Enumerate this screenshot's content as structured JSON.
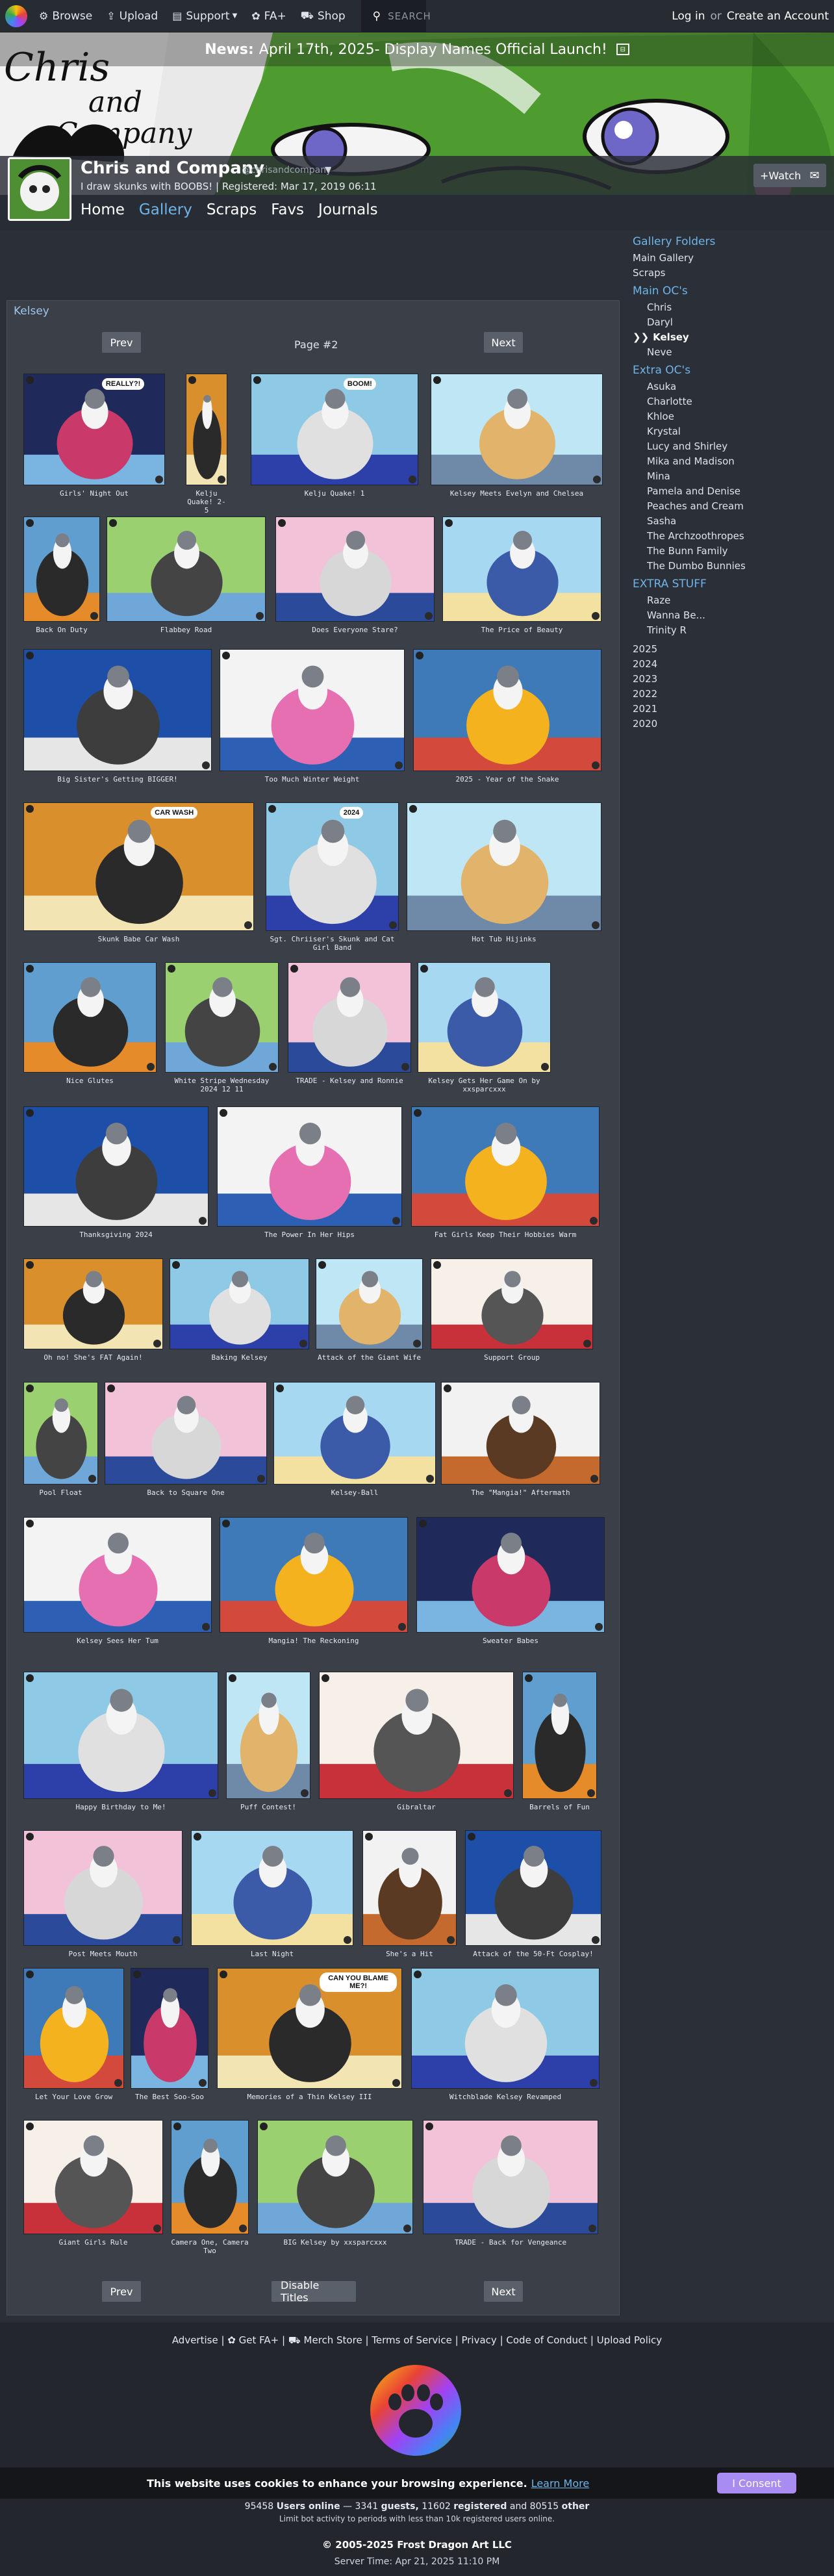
{
  "nav": {
    "browse": "Browse",
    "upload": "Upload",
    "support": "Support",
    "faplus": "FA+",
    "shop": "Shop",
    "search_placeholder": "SEARCH",
    "login": "Log in",
    "or": "or",
    "create": "Create an Account"
  },
  "news": {
    "label": "News:",
    "text": "April 17th, 2025- Display Names Official Launch!"
  },
  "banner_text": {
    "line1": "Chris",
    "line2": "and",
    "line3": "Company"
  },
  "user": {
    "name": "Chris and Company",
    "status": "@chrisandcompany",
    "tagline": "I draw skunks with BOOBS! | Registered: Mar 17, 2019 06:11",
    "watch": "+Watch",
    "tabs": [
      "Home",
      "Gallery",
      "Scraps",
      "Favs",
      "Journals"
    ]
  },
  "sidebar": {
    "gallery_folders": "Gallery Folders",
    "main_gallery": "Main Gallery",
    "scraps": "Scraps",
    "main_ocs": "Main OC's",
    "main_oc_items": [
      "Chris",
      "Daryl",
      "Kelsey",
      "Neve"
    ],
    "current_marker": "❯❯",
    "extra_ocs": "Extra OC's",
    "extra_oc_items": [
      "Asuka",
      "Charlotte",
      "Khloe",
      "Krystal",
      "Lucy and Shirley",
      "Mika and Madison",
      "Mina",
      "Pamela and Denise",
      "Peaches and Cream",
      "Sasha",
      "The Archzoothropes",
      "The Bunn Family",
      "The Dumbo Bunnies"
    ],
    "extra_stuff": "EXTRA STUFF",
    "extra_stuff_items": [
      "Raze",
      "Wanna Be...",
      "Trinity R"
    ],
    "years": [
      "2025",
      "2024",
      "2023",
      "2022",
      "2021",
      "2020"
    ]
  },
  "gallery": {
    "title": "Kelsey",
    "prev": "Prev",
    "next": "Next",
    "page": "Page #2",
    "disable_titles": "Disable Titles",
    "thumbs": [
      {
        "caption": "Girls' Night Out",
        "bubble": "REALLY?!"
      },
      {
        "caption": "Kelju Quake! 2-5"
      },
      {
        "caption": "Kelju Quake! 1",
        "bubble": "BOOM!"
      },
      {
        "caption": "Kelsey Meets Evelyn and Chelsea"
      },
      {
        "caption": "Back On Duty"
      },
      {
        "caption": "Flabbey Road"
      },
      {
        "caption": "Does Everyone Stare?"
      },
      {
        "caption": "The Price of Beauty"
      },
      {
        "caption": "Big Sister's Getting BIGGER!"
      },
      {
        "caption": "Too Much Winter Weight"
      },
      {
        "caption": "2025 - Year of the Snake"
      },
      {
        "caption": "Skunk Babe Car Wash",
        "bubble": "CAR WASH"
      },
      {
        "caption": "Sgt. Chriiser's Skunk and Cat Girl Band",
        "bubble": "2024"
      },
      {
        "caption": "Hot Tub Hijinks"
      },
      {
        "caption": "Nice Glutes"
      },
      {
        "caption": "White Stripe Wednesday 2024 12 11"
      },
      {
        "caption": "TRADE - Kelsey and Ronnie"
      },
      {
        "caption": "Kelsey Gets Her Game On by xxsparcxxx"
      },
      {
        "caption": "Thanksgiving 2024"
      },
      {
        "caption": "The Power In Her Hips"
      },
      {
        "caption": "Fat Girls Keep Their Hobbies Warm"
      },
      {
        "caption": "Oh no! She's FAT Again!"
      },
      {
        "caption": "Baking Kelsey"
      },
      {
        "caption": "Attack of the Giant Wife"
      },
      {
        "caption": "Support Group"
      },
      {
        "caption": "Pool Float"
      },
      {
        "caption": "Back to Square One"
      },
      {
        "caption": "Kelsey-Ball"
      },
      {
        "caption": "The \"Mangia!\" Aftermath"
      },
      {
        "caption": "Kelsey Sees Her Tum"
      },
      {
        "caption": "Mangia! The Reckoning"
      },
      {
        "caption": "Sweater Babes"
      },
      {
        "caption": "Happy Birthday to Me!"
      },
      {
        "caption": "Puff Contest!"
      },
      {
        "caption": "Gibraltar"
      },
      {
        "caption": "Barrels of Fun"
      },
      {
        "caption": "Post Meets Mouth"
      },
      {
        "caption": "Last Night"
      },
      {
        "caption": "She's a Hit"
      },
      {
        "caption": "Attack of the 50-Ft Cosplay!"
      },
      {
        "caption": "Let Your Love Grow"
      },
      {
        "caption": "The Best Soo-Soo"
      },
      {
        "caption": "Memories of a Thin Kelsey III",
        "bubble": "CAN YOU BLAME ME?!"
      },
      {
        "caption": "Witchblade Kelsey Revamped"
      },
      {
        "caption": "Giant Girls Rule"
      },
      {
        "caption": "Camera One, Camera Two"
      },
      {
        "caption": "BIG Kelsey by xxsparcxxx"
      },
      {
        "caption": "TRADE - Back for Vengeance"
      }
    ]
  },
  "footer": {
    "advertise": "Advertise",
    "get_fa_plus": "Get FA+",
    "merch": "Merch Store",
    "tos": "Terms of Service",
    "privacy": "Privacy",
    "coc": "Code of Conduct",
    "upload_policy": "Upload Policy",
    "cookie_text": "This website uses cookies to enhance your browsing experience.",
    "learn_more": "Learn More",
    "consent": "I Consent",
    "stats_count": "95458",
    "stats_users": "Users online",
    "stats_guests_n": "3341",
    "stats_guests": "guests,",
    "stats_reg_n": "11602",
    "stats_reg": "registered",
    "stats_and": "and",
    "stats_other_n": "80515",
    "stats_other": "other",
    "limit": "Limit bot activity to periods with less than 10k registered users online.",
    "copyright": "© 2005-2025 Frost Dragon Art LLC",
    "server_time": "Server Time: Apr 21, 2025 11:10 PM"
  },
  "colors": {
    "accent": "#6fb4e8",
    "panel": "#3a3f48",
    "bg": "#2b2f37",
    "consent": "#a98cf2"
  }
}
